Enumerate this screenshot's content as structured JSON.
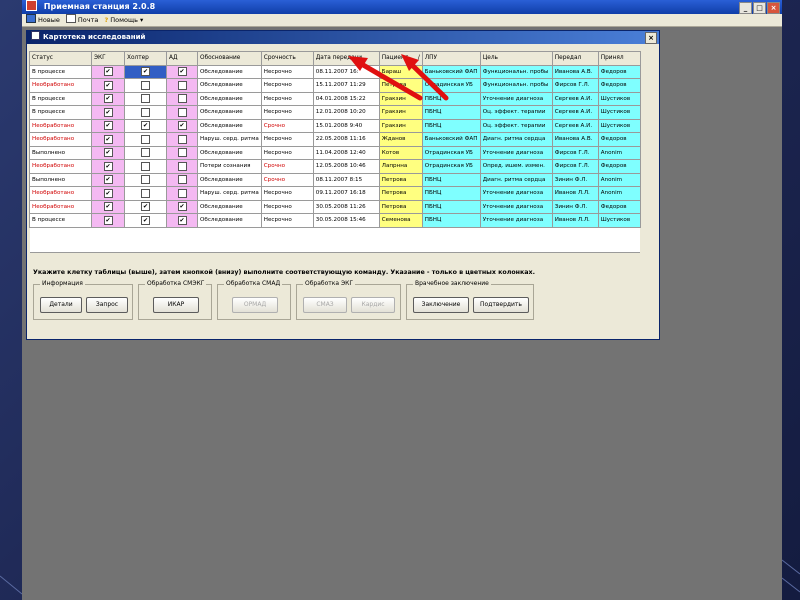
{
  "app": {
    "title": "Приемная станция 2.0.8",
    "window_buttons": [
      "_",
      "□",
      "×"
    ]
  },
  "menu": [
    {
      "label": "Новые",
      "icon": "new-icon"
    },
    {
      "label": "Почта",
      "icon": "mail-icon"
    },
    {
      "label": "Помощь",
      "icon": "help-icon"
    }
  ],
  "menu_dropdown": "▾",
  "dialog": {
    "title": "Картотека исследований",
    "close": "×"
  },
  "table": {
    "columns": [
      "Статус",
      "ЭКГ",
      "Холтер",
      "АД",
      "Обоснование",
      "Срочность",
      "Дата передачи",
      "Пациент",
      "ЛПУ",
      "Цель",
      "Передал",
      "Принял"
    ],
    "rows": [
      {
        "status": "В процессе",
        "ekg": true,
        "holter": true,
        "ad": true,
        "reason": "Обследование",
        "urgency": "Несрочно",
        "date": "08.11.2007 16:",
        "patient": "Бараш",
        "lpu": "Баньковский ФАП",
        "goal": "Функциональн. пробы",
        "sender": "Иванова А.В.",
        "receiver": "Федоров",
        "selected": true
      },
      {
        "status": "Необработано",
        "ekg": true,
        "holter": false,
        "ad": false,
        "reason": "Обследование",
        "urgency": "Несрочно",
        "date": "15.11.2007 11:29",
        "patient": "Петрова",
        "lpu": "Отрадинская УБ",
        "goal": "Функциональн. пробы",
        "sender": "Фирсов Г.Л.",
        "receiver": "Федоров"
      },
      {
        "status": "В процессе",
        "ekg": true,
        "holter": false,
        "ad": false,
        "reason": "Обследование",
        "urgency": "Несрочно",
        "date": "04.01.2008 15:22",
        "patient": "Гракзин",
        "lpu": "ПБНЦ",
        "goal": "Уточнение диагноза",
        "sender": "Сергеев А.И.",
        "receiver": "Шустиков"
      },
      {
        "status": "В процессе",
        "ekg": true,
        "holter": false,
        "ad": false,
        "reason": "Обследование",
        "urgency": "Несрочно",
        "date": "12.01.2008 10:20",
        "patient": "Гракзин",
        "lpu": "ПБНЦ",
        "goal": "Оц. эффект. терапии",
        "sender": "Сергеев А.И.",
        "receiver": "Шустиков"
      },
      {
        "status": "Необработано",
        "ekg": true,
        "holter": true,
        "ad": true,
        "reason": "Обследование",
        "urgency": "Срочно",
        "date": "15.01.2008 9:40",
        "patient": "Гракзин",
        "lpu": "ПБНЦ",
        "goal": "Оц. эффект. терапии",
        "sender": "Сергеев А.И.",
        "receiver": "Шустиков"
      },
      {
        "status": "Необработано",
        "ekg": true,
        "holter": false,
        "ad": false,
        "reason": "Наруш. серд. ритма",
        "urgency": "Несрочно",
        "date": "22.05.2008 11:16",
        "patient": "Жданов",
        "lpu": "Баньковский ФАП",
        "goal": "Диагн. ритма сердца",
        "sender": "Иванова А.В.",
        "receiver": "Федоров"
      },
      {
        "status": "Выполнено",
        "ekg": true,
        "holter": false,
        "ad": false,
        "reason": "Обследование",
        "urgency": "Несрочно",
        "date": "11.04.2008 12:40",
        "patient": "Котов",
        "lpu": "Отрадинская УБ",
        "goal": "Уточнение диагноза",
        "sender": "Фирсов Г.Л.",
        "receiver": "Anonim"
      },
      {
        "status": "Необработано",
        "ekg": true,
        "holter": false,
        "ad": false,
        "reason": "Потери сознания",
        "urgency": "Срочно",
        "date": "12.05.2008 10:46",
        "patient": "Лапрнна",
        "lpu": "Отрадинская УБ",
        "goal": "Опред. ишем. измен.",
        "sender": "Фирсов Г.Л.",
        "receiver": "Федоров"
      },
      {
        "status": "Выполнено",
        "ekg": true,
        "holter": false,
        "ad": false,
        "reason": "Обследование",
        "urgency": "Срочно",
        "date": "08.11.2007 8:15",
        "patient": "Петрова",
        "lpu": "ПБНЦ",
        "goal": "Диагн. ритма сердца",
        "sender": "Зинин Ф.Л.",
        "receiver": "Anonim"
      },
      {
        "status": "Необработано",
        "ekg": true,
        "holter": false,
        "ad": false,
        "reason": "Наруш. серд. ритма",
        "urgency": "Несрочно",
        "date": "09.11.2007 16:18",
        "patient": "Петрова",
        "lpu": "ПБНЦ",
        "goal": "Уточнение диагноза",
        "sender": "Иванов Л.Л.",
        "receiver": "Anonim"
      },
      {
        "status": "Необработано",
        "ekg": true,
        "holter": true,
        "ad": true,
        "reason": "Обследование",
        "urgency": "Несрочно",
        "date": "30.05.2008 11:26",
        "patient": "Петрова",
        "lpu": "ПБНЦ",
        "goal": "Уточнение диагноза",
        "sender": "Зинин Ф.Л.",
        "receiver": "Федоров"
      },
      {
        "status": "В процессе",
        "ekg": true,
        "holter": true,
        "ad": true,
        "reason": "Обследование",
        "urgency": "Несрочно",
        "date": "30.05.2008 15:46",
        "patient": "Семенова",
        "lpu": "ПБНЦ",
        "goal": "Уточнение диагноза",
        "sender": "Иванов Л.Л.",
        "receiver": "Шустиков"
      }
    ]
  },
  "hint": "Укажите клетку таблицы (выше), затем кнопкой (внизу) выполните соответствующую команду. Указание - только в цветных колонках.",
  "groups": [
    {
      "title": "Информация",
      "buttons": [
        {
          "label": "Детали",
          "enabled": true
        },
        {
          "label": "Запрос",
          "enabled": true
        }
      ]
    },
    {
      "title": "Обработка СМЭКГ",
      "buttons": [
        {
          "label": "ИКАР",
          "enabled": true
        }
      ]
    },
    {
      "title": "Обработка СМАД",
      "buttons": [
        {
          "label": "ОРМАД",
          "enabled": false
        }
      ]
    },
    {
      "title": "Обработка ЭКГ",
      "buttons": [
        {
          "label": "СМАЗ",
          "enabled": false
        },
        {
          "label": "Кардис",
          "enabled": false
        }
      ]
    },
    {
      "title": "Врачебное заключение",
      "buttons": [
        {
          "label": "Заключение",
          "enabled": true
        },
        {
          "label": "Подтвердить",
          "enabled": true
        }
      ]
    }
  ],
  "check_mark": "✔",
  "colors": {
    "pink": "#f4b9f2",
    "yellow": "#ffff80",
    "cyan": "#7fffff",
    "selection": "#315ec4",
    "status_red": "#d00000",
    "arrow": "#e01010"
  }
}
